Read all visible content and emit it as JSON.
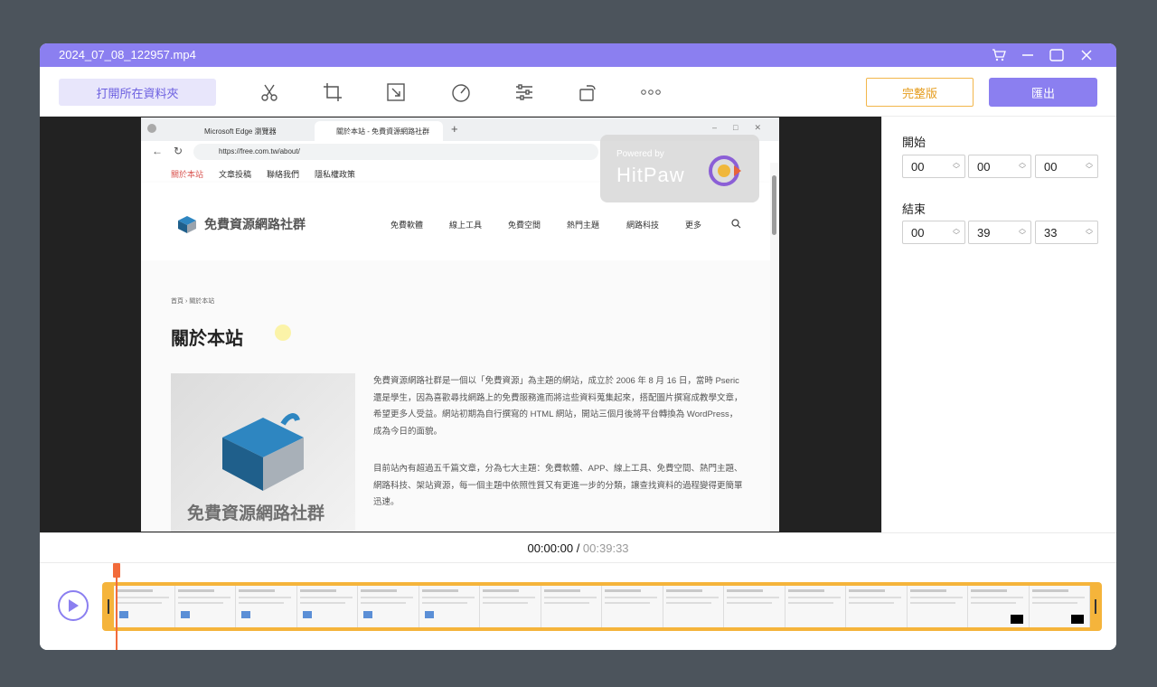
{
  "window": {
    "title": "2024_07_08_122957.mp4"
  },
  "toolbar": {
    "open_folder_label": "打開所在資料夾",
    "full_version_label": "完整版",
    "export_label": "匯出",
    "tools": [
      "scissors-icon",
      "crop-icon",
      "resize-icon",
      "speed-icon",
      "adjust-icon",
      "rotate-icon",
      "more-icon"
    ]
  },
  "sidebar": {
    "start_label": "開始",
    "start": [
      "00",
      "00",
      "00"
    ],
    "end_label": "結束",
    "end": [
      "00",
      "39",
      "33"
    ]
  },
  "playback": {
    "current": "00:00:00",
    "separator": " / ",
    "total": "00:39:33"
  },
  "preview": {
    "tabs": [
      "Microsoft Edge 瀏覽器",
      "關於本站 - 免費資源網路社群"
    ],
    "url": "https://free.com.tw/about/",
    "bookmarks": [
      "關於本站",
      "文章投稿",
      "聯絡我們",
      "隱私權政策"
    ],
    "site_name": "免費資源網路社群",
    "nav": [
      "免費軟體",
      "線上工具",
      "免費空間",
      "熱門主題",
      "網路科技",
      "更多"
    ],
    "breadcrumb": "首頁 › 關於本站",
    "heading": "關於本站",
    "image_caption": "免費資源網路社群",
    "para1": "免費資源網路社群是一個以「免費資源」為主題的網站，成立於 2006 年 8 月 16 日，當時 Pseric 還是學生，因為喜歡尋找網路上的免費服務進而將這些資料蒐集起來，搭配圖片撰寫成教學文章，希望更多人受益。網站初期為自行撰寫的 HTML 網站，開站三個月後將平台轉換為 WordPress，成為今日的面貌。",
    "para2": "目前站內有超過五千篇文章，分為七大主題：免費軟體、APP、線上工具、免費空間、熱門主題、網路科技、架站資源，每一個主題中依照性質又有更進一步的分類，讓查找資料的過程變得更簡單迅速。",
    "watermark_small": "Powered by",
    "watermark_brand": "HitPaw"
  },
  "colors": {
    "accent": "#8b7ff0",
    "gold": "#f5b43b",
    "playhead": "#f26b3a"
  }
}
